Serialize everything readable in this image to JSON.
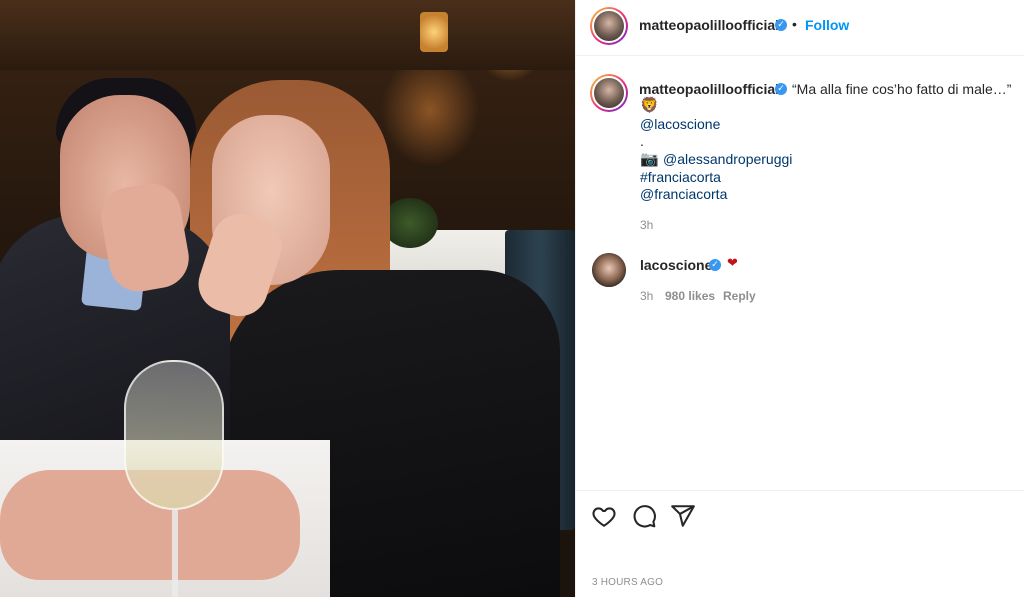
{
  "post": {
    "username": "matteopaolilloofficial",
    "follow_label": "Follow",
    "separator": "•",
    "caption_quote": "“Ma alla fine cos’ho fatto di male…”",
    "caption_emoji": "🦁",
    "mention_1": "@lacoscione",
    "dot_line": ".",
    "camera_emoji": "📷",
    "mention_2": "@alessandroperuggi",
    "hashtag": "#franciacorta",
    "mention_3": "@franciacorta",
    "caption_time": "3h",
    "timestamp": "3 HOURS AGO"
  },
  "comment": {
    "username": "lacoscione",
    "time": "3h",
    "likes": "980 likes",
    "reply_label": "Reply",
    "heart": "❤"
  },
  "icons": {
    "verified": "✓",
    "like": "heart-icon",
    "comment": "comment-icon",
    "share": "share-icon"
  },
  "colors": {
    "follow": "#0095f6",
    "verified": "#3897f0",
    "link": "#00376b"
  }
}
